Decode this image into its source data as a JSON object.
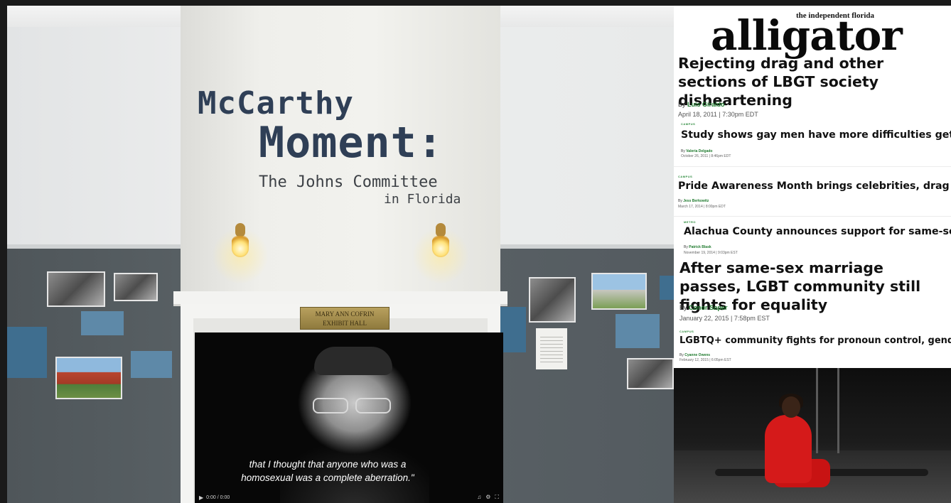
{
  "exhibit": {
    "title_line1": "McCarthy",
    "title_line2": "Moment:",
    "subtitle_line1": "The Johns Committee",
    "subtitle_line2": "in Florida",
    "plaque_line1": "MARY ANN COFRIN",
    "plaque_line2": "EXHIBIT HALL"
  },
  "video": {
    "caption_line1": "that I thought that anyone who was a",
    "caption_line2": "homosexual was a complete aberration.\"",
    "play_icon": "play-icon",
    "time": "0:00 / 0:00"
  },
  "newspaper": {
    "kicker": "the independent florida",
    "masthead": "alligator",
    "articles": [
      {
        "headline": "Rejecting drag and other sections of LBGT society disheartening",
        "byline_prefix": "By",
        "author": "Luis Giraldo",
        "date": "April 18, 2011 | 7:30pm EDT"
      },
      {
        "category": "CAMPUS",
        "headline": "Study shows gay men have more difficulties getting jobs",
        "byline_prefix": "By",
        "author": "Valeria Delgado",
        "date": "October 26, 2011 | 8:46pm EDT"
      },
      {
        "category": "CAMPUS",
        "headline": "Pride Awareness Month brings celebrities, drag queens to UF",
        "byline_prefix": "By",
        "author": "Jess Berkowitz",
        "date": "March 17, 2014 | 8:00pm EDT"
      },
      {
        "category": "METRO",
        "headline": "Alachua County announces support for same-sex marriage",
        "byline_prefix": "By",
        "author": "Patrick Blask",
        "date": "November 19, 2014 | 9:03pm EST"
      },
      {
        "headline": "After same-sex marriage passes, LGBT community still fights for equality",
        "byline_prefix": "By",
        "author": "Conor Soper",
        "date": "January 22, 2015 | 7:58pm EST"
      },
      {
        "category": "CAMPUS",
        "headline": "LGBTQ+ community fights for pronoun control, gender equality",
        "byline_prefix": "By",
        "author": "Cyanne Owens",
        "date": "February 12, 2015 | 6:05pm EST"
      }
    ]
  },
  "colors": {
    "accent_green": "#1f7a2e",
    "title_blue": "#2f3f56",
    "performer_red": "#d51a1a"
  }
}
